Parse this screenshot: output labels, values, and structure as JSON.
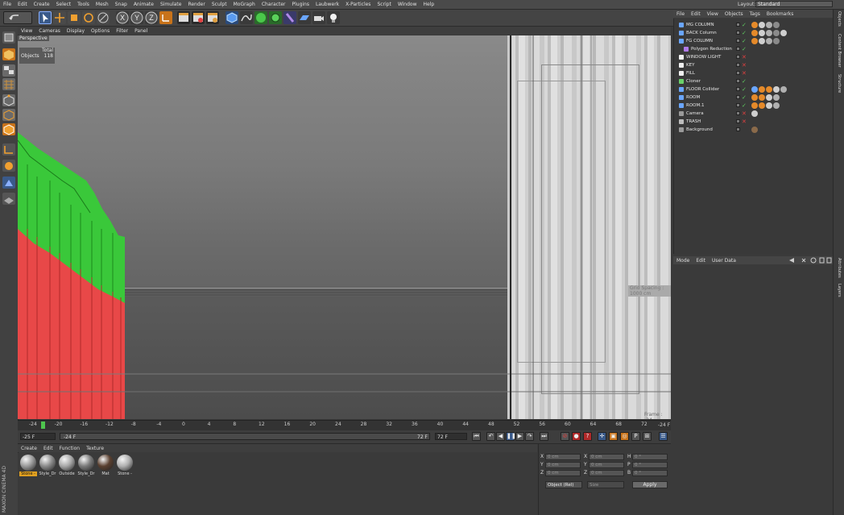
{
  "menubar": {
    "items": [
      "File",
      "Edit",
      "Create",
      "Select",
      "Tools",
      "Mesh",
      "Snap",
      "Animate",
      "Simulate",
      "Render",
      "Sculpt",
      "MoGraph",
      "Character",
      "Plugins",
      "Laubwerk",
      "X-Particles",
      "Script",
      "Window",
      "Help"
    ],
    "layout_label": "Layout:",
    "layout_value": "Standard"
  },
  "viewport": {
    "menu": [
      "View",
      "Cameras",
      "Display",
      "Options",
      "Filter",
      "Panel"
    ],
    "camera_label": "Perspective",
    "stats_total": "Total",
    "stats_objects_label": "Objects",
    "stats_objects_value": "118",
    "safe_frame_label": "Grid Spacing : 1000 cm",
    "footer_text": "Frame : -24"
  },
  "object_manager": {
    "menu": [
      "File",
      "Edit",
      "View",
      "Objects",
      "Tags",
      "Bookmarks"
    ],
    "objects": [
      {
        "name": "MG COLUMN",
        "indent": 0,
        "icon_color": "#6aa6ff",
        "check": "✓",
        "check_color": "#5ec85e",
        "tags": [
          "#e58a2a",
          "#cfcfcf",
          "#b0b0b0",
          "#8a8a8a"
        ]
      },
      {
        "name": "BACK Column",
        "indent": 0,
        "icon_color": "#6aa6ff",
        "check": "✓",
        "check_color": "#5ec85e",
        "tags": [
          "#e58a2a",
          "#cfcfcf",
          "#b0b0b0",
          "#8a8a8a",
          "#cfcfcf"
        ]
      },
      {
        "name": "FG COLUMN",
        "indent": 0,
        "icon_color": "#6aa6ff",
        "check": "✓",
        "check_color": "#5ec85e",
        "tags": [
          "#e58a2a",
          "#cfcfcf",
          "#b0b0b0",
          "#8a8a8a"
        ]
      },
      {
        "name": "Polygon Reduction",
        "indent": 1,
        "icon_color": "#b07ae8",
        "check": "✓",
        "check_color": "#5ec85e",
        "tags": []
      },
      {
        "name": "WINDOW LIGHT",
        "indent": 0,
        "icon_color": "#f0f0f0",
        "check": "✕",
        "check_color": "#e04040",
        "tags": []
      },
      {
        "name": "KEY",
        "indent": 0,
        "icon_color": "#f0f0f0",
        "check": "✕",
        "check_color": "#e04040",
        "tags": []
      },
      {
        "name": "FILL",
        "indent": 0,
        "icon_color": "#f0f0f0",
        "check": "✕",
        "check_color": "#e04040",
        "tags": []
      },
      {
        "name": "Cloner",
        "indent": 0,
        "icon_color": "#6ad16a",
        "check": "✓",
        "check_color": "#5ec85e",
        "tags": []
      },
      {
        "name": "FLOOR Collider",
        "indent": 0,
        "icon_color": "#6aa6ff",
        "check": "✓",
        "check_color": "#5ec85e",
        "tags": [
          "#6aa6ff",
          "#e58a2a",
          "#e58a2a",
          "#cfcfcf",
          "#b0b0b0"
        ]
      },
      {
        "name": "ROOM",
        "indent": 0,
        "icon_color": "#6aa6ff",
        "check": "✓",
        "check_color": "#5ec85e",
        "tags": [
          "#e58a2a",
          "#e58a2a",
          "#cfcfcf",
          "#b0b0b0"
        ]
      },
      {
        "name": "ROOM.1",
        "indent": 0,
        "icon_color": "#6aa6ff",
        "check": "✓",
        "check_color": "#5ec85e",
        "tags": [
          "#e58a2a",
          "#e58a2a",
          "#cfcfcf",
          "#b0b0b0"
        ]
      },
      {
        "name": "Camera",
        "indent": 0,
        "icon_color": "#9a9a9a",
        "check": "✕",
        "check_color": "#e04040",
        "tags": [
          "#cfcfcf"
        ]
      },
      {
        "name": "TRASH",
        "indent": 0,
        "icon_color": "#bdbdbd",
        "check": "✕",
        "check_color": "#e04040",
        "tags": []
      },
      {
        "name": "Background",
        "indent": 0,
        "icon_color": "#9a9a9a",
        "check": "",
        "check_color": "#5ec85e",
        "tags": [
          "#8a6a4a"
        ]
      }
    ]
  },
  "side_tabs": [
    "Objects",
    "Content Browser",
    "Structure",
    "Attributes",
    "Layers"
  ],
  "attributes": {
    "menu": [
      "Mode",
      "Edit",
      "User Data"
    ]
  },
  "timeline": {
    "ticks": [
      "-24",
      "-20",
      "-16",
      "-12",
      "-8",
      "-4",
      "0",
      "4",
      "8",
      "12",
      "16",
      "20",
      "24",
      "28",
      "32",
      "36",
      "40",
      "44",
      "48",
      "52",
      "56",
      "60",
      "64",
      "68",
      "72"
    ],
    "end_label": "-24 F",
    "current_frame_progress": 0.02
  },
  "transport": {
    "start_field": "-25 F",
    "range_start": "-24 F",
    "range_end": "72 F",
    "end_field": "72 F"
  },
  "material_manager": {
    "menu": [
      "Create",
      "Edit",
      "Function",
      "Texture"
    ],
    "materials": [
      {
        "name": "Stone -",
        "color": "#9a9a9a",
        "selected": true
      },
      {
        "name": "Style_Dr",
        "color": "#8a8a8a",
        "selected": false
      },
      {
        "name": "Outside",
        "color": "#a8a8a8",
        "selected": false
      },
      {
        "name": "Style_Dr",
        "color": "#7a7a7a",
        "selected": false
      },
      {
        "name": "Mat",
        "color": "#5a4030",
        "selected": false
      },
      {
        "name": "Stone -",
        "color": "#b0b0b0",
        "selected": false
      }
    ]
  },
  "coordinates": {
    "rows": [
      {
        "a": "X",
        "a_val": "0 cm",
        "b": "X",
        "b_val": "0 cm",
        "c": "H",
        "c_val": "0 °"
      },
      {
        "a": "Y",
        "a_val": "0 cm",
        "b": "Y",
        "b_val": "0 cm",
        "c": "P",
        "c_val": "0 °"
      },
      {
        "a": "Z",
        "a_val": "0 cm",
        "b": "Z",
        "b_val": "0 cm",
        "c": "B",
        "c_val": "0 °"
      }
    ],
    "mode_select": "Object (Rel)",
    "size_select": "Size",
    "apply_label": "Apply"
  },
  "logo_text": "MAXON CINEMA 4D"
}
